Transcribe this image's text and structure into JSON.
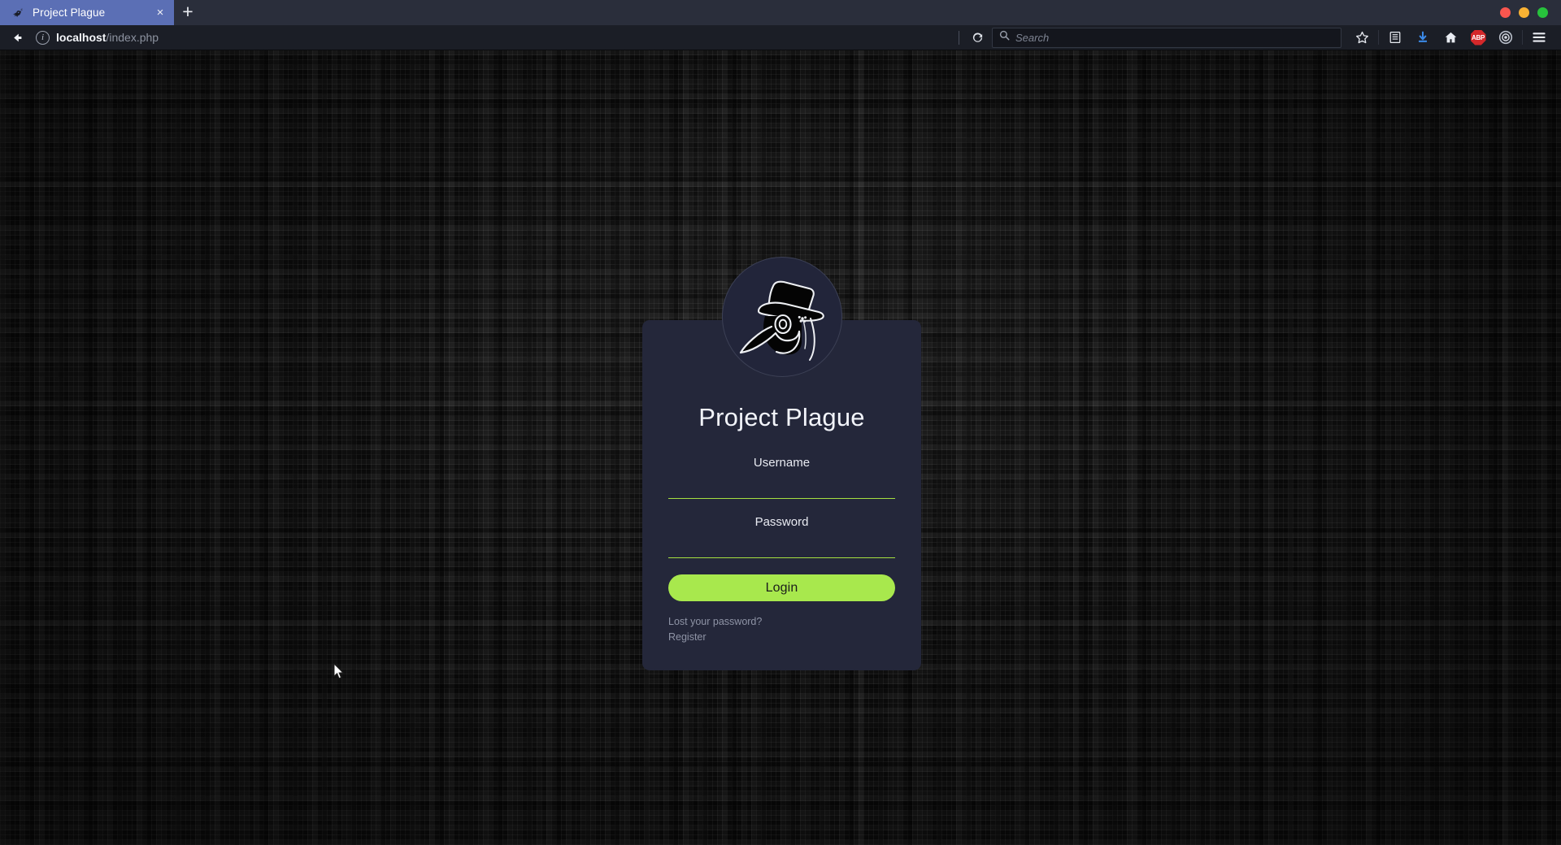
{
  "browser": {
    "tab": {
      "title": "Project Plague",
      "favicon_icon": "plague-doctor-favicon",
      "close_icon": "×"
    },
    "newtab_label": "+",
    "window_controls": [
      {
        "name": "close",
        "color": "#f9564f"
      },
      {
        "name": "minimize",
        "color": "#f9b233"
      },
      {
        "name": "maximize",
        "color": "#27c23c"
      }
    ],
    "nav": {
      "back_icon": "arrow-left",
      "info_icon": "i",
      "url_host": "localhost",
      "url_path": "/index.php",
      "reload_icon": "reload-arrow"
    },
    "search": {
      "placeholder": "Search",
      "icon": "search-icon"
    },
    "toolbar_icons": [
      {
        "name": "bookmark-star-icon",
        "glyph": "star"
      },
      {
        "name": "library-icon",
        "glyph": "library"
      },
      {
        "name": "downloads-icon",
        "glyph": "down-arrow"
      },
      {
        "name": "home-icon",
        "glyph": "house"
      },
      {
        "name": "adblock-plus-icon",
        "glyph": "ABP"
      },
      {
        "name": "privacy-badger-icon",
        "glyph": "eye-circle"
      },
      {
        "name": "menu-icon",
        "glyph": "hamburger"
      }
    ]
  },
  "page": {
    "logo_icon": "plague-doctor-mask-logo",
    "title": "Project Plague",
    "fields": [
      {
        "label": "Username",
        "value": "",
        "placeholder": "",
        "type": "text",
        "name": "username"
      },
      {
        "label": "Password",
        "value": "",
        "placeholder": "",
        "type": "password",
        "name": "password"
      }
    ],
    "login_button": "Login",
    "links": [
      {
        "label": "Lost your password?",
        "name": "lost-password-link"
      },
      {
        "label": "Register",
        "name": "register-link"
      }
    ],
    "colors": {
      "accent_green": "#a8e84d",
      "underline_green": "#a6e040",
      "card_bg": "#24273a",
      "page_bg": "#0b0b0b",
      "link": "#8f94a6"
    }
  }
}
